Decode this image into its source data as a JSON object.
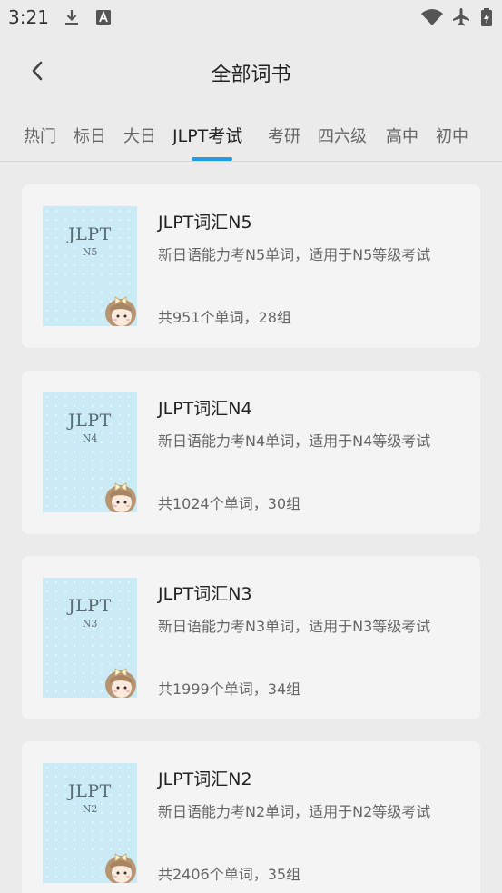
{
  "status_bar": {
    "time": "3:21",
    "left_icons": [
      "download-icon",
      "notification-a-icon"
    ],
    "right_icons": [
      "wifi-icon",
      "airplane-icon",
      "battery-charging-icon"
    ]
  },
  "header": {
    "back_icon": "chevron-left-icon",
    "title": "全部词书"
  },
  "tabs": [
    {
      "label": "热门"
    },
    {
      "label": "标日"
    },
    {
      "label": "大日"
    },
    {
      "label": "JLPT考试",
      "active": true
    },
    {
      "label": "考研"
    },
    {
      "label": "四六级"
    },
    {
      "label": "高中"
    },
    {
      "label": "初中"
    }
  ],
  "accent_color": "#1e9de8",
  "books": [
    {
      "cover_title": "JLPT",
      "cover_sub": "N5",
      "title": "JLPT词汇N5",
      "desc": "新日语能力考N5单词，适用于N5等级考试",
      "stats": "共951个单词，28组"
    },
    {
      "cover_title": "JLPT",
      "cover_sub": "N4",
      "title": "JLPT词汇N4",
      "desc": "新日语能力考N4单词，适用于N4等级考试",
      "stats": "共1024个单词，30组"
    },
    {
      "cover_title": "JLPT",
      "cover_sub": "N3",
      "title": "JLPT词汇N3",
      "desc": "新日语能力考N3单词，适用于N3等级考试",
      "stats": "共1999个单词，34组"
    },
    {
      "cover_title": "JLPT",
      "cover_sub": "N2",
      "title": "JLPT词汇N2",
      "desc": "新日语能力考N2单词，适用于N2等级考试",
      "stats": "共2406个单词，35组"
    }
  ]
}
